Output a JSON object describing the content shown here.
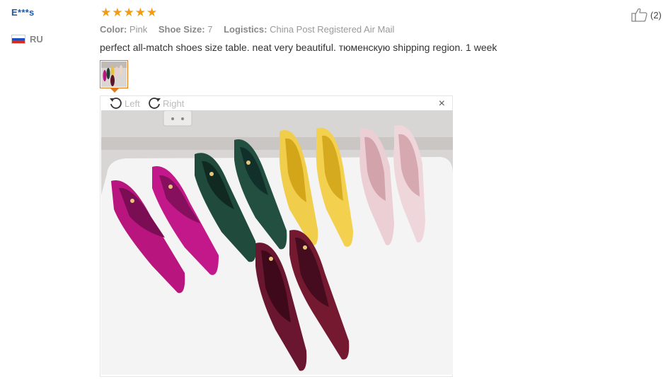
{
  "reviewer": {
    "name": "E***s",
    "country_code": "RU",
    "flag_colors": [
      "#ffffff",
      "#1f4fbf",
      "#d52b1e"
    ]
  },
  "rating": {
    "stars": 5,
    "star_glyph": "★",
    "color": "#f39c12"
  },
  "attributes": [
    {
      "label": "Color:",
      "value": "Pink"
    },
    {
      "label": "Shoe Size:",
      "value": "7"
    },
    {
      "label": "Logistics:",
      "value": "China Post Registered Air Mail"
    }
  ],
  "feedback": "perfect all-match shoes size table. neat very beautiful. тюменскую shipping region. 1 week",
  "helpful": {
    "count": "(2)",
    "icon": "thumbs-up-icon"
  },
  "viewer": {
    "rotate_left_label": "Left",
    "rotate_right_label": "Right",
    "close_glyph": "×",
    "image_subject": "six pairs of suede pointed-toe heels: magenta, dark green, yellow, pale pink, wine red"
  }
}
